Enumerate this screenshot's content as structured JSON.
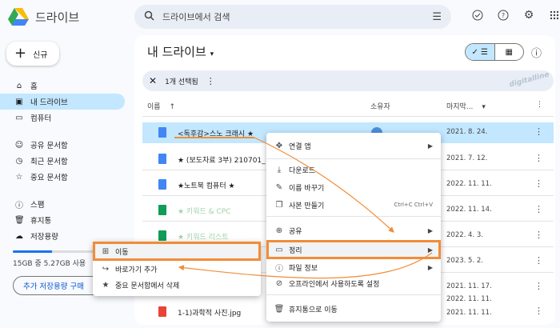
{
  "app": {
    "title": "드라이브"
  },
  "search": {
    "placeholder": "드라이브에서 검색"
  },
  "header_icons": [
    "offline-check-icon",
    "help-icon",
    "settings-icon",
    "apps-grid-icon"
  ],
  "sidebar": {
    "new_label": "신규",
    "items": [
      {
        "label": "홈",
        "icon": "home-icon"
      },
      {
        "label": "내 드라이브",
        "icon": "my-drive-icon",
        "active": true
      },
      {
        "label": "컴퓨터",
        "icon": "computer-icon"
      },
      {
        "label": "공유 문서함",
        "icon": "shared-icon"
      },
      {
        "label": "최근 문서함",
        "icon": "recent-icon"
      },
      {
        "label": "중요 문서함",
        "icon": "star-icon"
      },
      {
        "label": "스팸",
        "icon": "spam-icon"
      },
      {
        "label": "휴지통",
        "icon": "trash-icon"
      },
      {
        "label": "저장용량",
        "icon": "cloud-icon"
      }
    ],
    "storage_text": "15GB 중 5.27GB 사용",
    "storage_fraction": 0.35,
    "buy_storage_label": "추가 저장용량 구매"
  },
  "main": {
    "title": "내 드라이브",
    "selection_text": "1개 선택됨",
    "watermark": "digitalline",
    "columns": {
      "name": "이름",
      "owner": "소유자",
      "modified": "마지막..."
    },
    "rows": [
      {
        "name": "<독후감>스노 크래시 ★",
        "owner": "나",
        "date": "2021. 8. 24.",
        "type": "doc",
        "selected": true
      },
      {
        "name": "★ (보도자료 3부) 210701_",
        "date": "2021. 7. 12.",
        "type": "doc"
      },
      {
        "name": "★노트북 컴퓨터 ★",
        "date": "2022. 11. 11.",
        "type": "doc"
      },
      {
        "name": "★ 키워드 & CPC",
        "date": "2022. 11. 14.",
        "type": "sheet"
      },
      {
        "name": "★ 키워드 리스트",
        "date": "2022. 4. 3.",
        "type": "sheet"
      },
      {
        "name": "",
        "date": "2023. 5. 2.",
        "type": "none"
      },
      {
        "name": "",
        "date": "2021. 11. 17.",
        "type": "none"
      },
      {
        "name": "",
        "date": "2022. 11. 11.",
        "type": "none"
      },
      {
        "name": "1-1)과학적 사진.jpg",
        "date": "2021. 11. 11.",
        "type": "img"
      }
    ]
  },
  "context_menu": {
    "items": [
      {
        "label": "연결 앱",
        "icon": "open-with-icon",
        "submenu": true
      },
      {
        "label": "다운로드",
        "icon": "download-icon"
      },
      {
        "label": "이름 바꾸기",
        "icon": "rename-icon"
      },
      {
        "label": "사본 만들기",
        "icon": "copy-icon",
        "shortcut": "Ctrl+C Ctrl+V"
      },
      {
        "label": "공유",
        "icon": "share-icon",
        "submenu": true
      },
      {
        "label": "정리",
        "icon": "organize-folder-icon",
        "submenu": true,
        "highlighted": true
      },
      {
        "label": "파일 정보",
        "icon": "info-icon",
        "submenu": true
      },
      {
        "label": "오프라인에서 사용하도록 설정",
        "icon": "offline-icon"
      },
      {
        "label": "휴지통으로 이동",
        "icon": "trash-icon"
      }
    ]
  },
  "submenu": {
    "items": [
      {
        "label": "이동",
        "icon": "move-folder-icon",
        "highlighted": true
      },
      {
        "label": "바로가기 추가",
        "icon": "add-shortcut-icon"
      },
      {
        "label": "중요 문서함에서 삭제",
        "icon": "star-icon"
      }
    ]
  },
  "colors": {
    "accent": "#c2e7ff",
    "highlight": "#f28c38",
    "primary": "#0b57d0"
  }
}
